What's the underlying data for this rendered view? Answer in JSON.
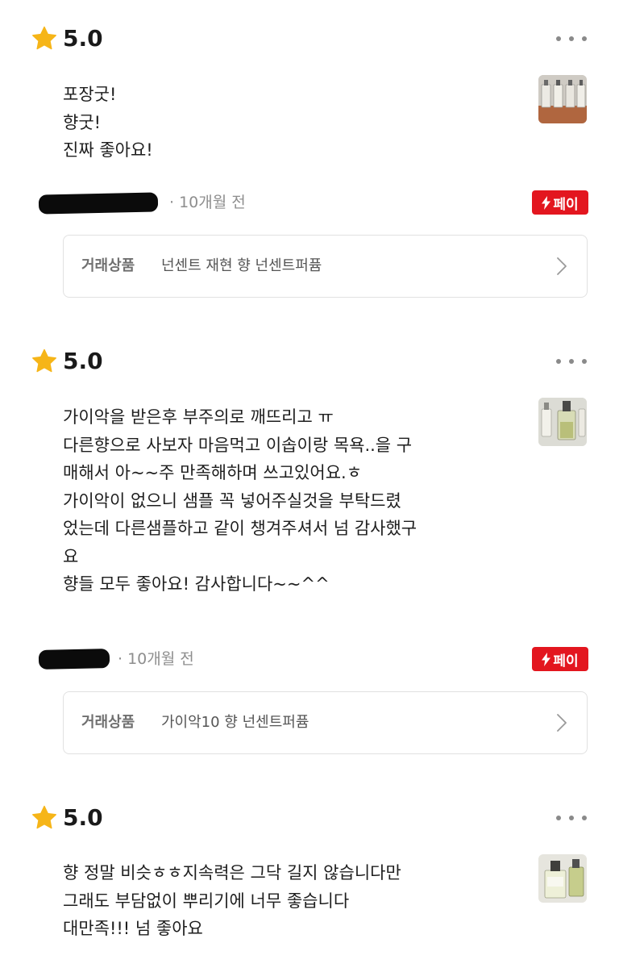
{
  "reviews": [
    {
      "rating": "5.0",
      "lines": [
        "포장굿!",
        "향굿!",
        "진짜 좋아요!"
      ],
      "time": "· 10개월 전",
      "pay_badge": "페이",
      "product_label": "거래상품",
      "product_name": "넌센트 재현 향 넌센트퍼퓸"
    },
    {
      "rating": "5.0",
      "lines": [
        "가이악을 받은후  부주의로 깨뜨리고 ㅠ",
        "다른향으로  사보자  마음먹고 이솝이랑  목욕..을  구",
        "매해서  아~~주 만족해하며  쓰고있어요.ㅎ",
        "가이악이   없으니   샘플  꼭  넣어주실것을 부탁드렸",
        "었는데  다른샘플하고  같이 챙겨주셔서  넘 감사했구",
        "요",
        "향들  모두  좋아요!  감사합니다~~^^"
      ],
      "time": "· 10개월 전",
      "pay_badge": "페이",
      "product_label": "거래상품",
      "product_name": "가이악10 향 넌센트퍼퓸"
    },
    {
      "rating": "5.0",
      "lines": [
        "향 정말 비슷ㅎㅎ지속력은 그닥 길지 않습니다만",
        "그래도 부담없이 뿌리기에 너무 좋습니다",
        "대만족!!! 넘 좋아요"
      ]
    }
  ],
  "colors": {
    "star": "#F6B518",
    "pay_badge": "#E3161F",
    "muted_text": "#8E8E8E",
    "card_border": "#E1E1E1"
  },
  "icons": [
    "star-icon",
    "more-options-icon",
    "lightning-bolt-icon",
    "chevron-right-icon"
  ]
}
